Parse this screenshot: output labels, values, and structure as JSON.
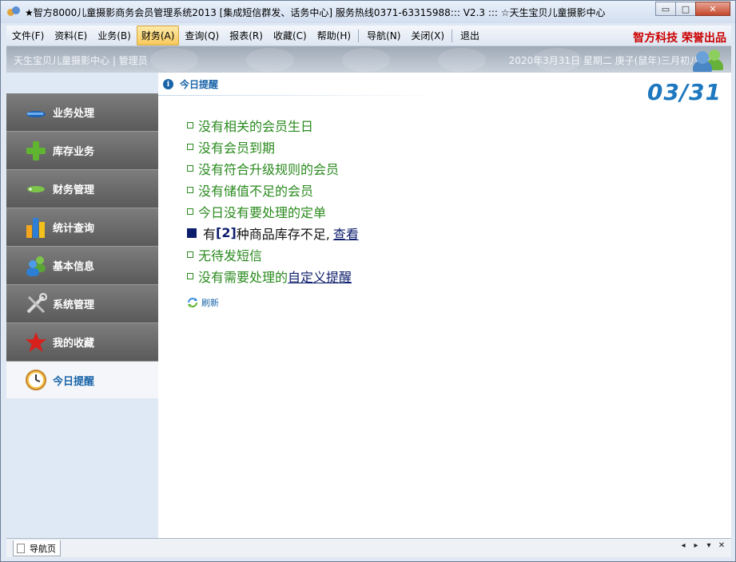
{
  "window": {
    "title": "★智方8000儿童摄影商务会员管理系统2013 [集成短信群发、话务中心] 服务热线0371-63315988::: V2.3 ::: ☆天生宝贝儿童摄影中心",
    "minimize_label": "▭",
    "maximize_label": "□",
    "close_label": "✕"
  },
  "menu": {
    "items": [
      "文件(F)",
      "资料(E)",
      "业务(B)",
      "财务(A)",
      "查询(Q)",
      "报表(R)",
      "收藏(C)",
      "帮助(H)",
      "导航(N)",
      "关闭(X)",
      "退出"
    ],
    "active": "财务(A)",
    "brand": "智方科技 荣誉出品"
  },
  "header": {
    "left": "天生宝贝儿童摄影中心 | 管理员",
    "right": "2020年3月31日  星期二  庚子(鼠年)三月初八"
  },
  "sidebar": {
    "items": [
      {
        "label": "业务处理",
        "icon": "pen-icon"
      },
      {
        "label": "库存业务",
        "icon": "plus-icon"
      },
      {
        "label": "财务管理",
        "icon": "tag-icon"
      },
      {
        "label": "统计查询",
        "icon": "bar-chart-icon"
      },
      {
        "label": "基本信息",
        "icon": "users-icon"
      },
      {
        "label": "系统管理",
        "icon": "tools-icon"
      },
      {
        "label": "我的收藏",
        "icon": "star-icon"
      },
      {
        "label": "今日提醒",
        "icon": "clock-icon"
      }
    ],
    "selected": "今日提醒"
  },
  "main": {
    "panel_title": "今日提醒",
    "date": "03/31",
    "alerts": [
      "没有相关的会员生日",
      "没有会员到期",
      "没有符合升级规则的会员",
      "没有储值不足的会员",
      "今日没有要处理的定单"
    ],
    "stock_alert": {
      "prefix": "有",
      "count": "[2]",
      "suffix": "种商品库存不足,",
      "link": "查看"
    },
    "sms_alert": "无待发短信",
    "custom_alert": {
      "prefix": "没有需要处理的",
      "link": "自定义提醒"
    },
    "refresh_label": "刷新"
  },
  "bottombar": {
    "tab_label": "导航页",
    "controls": [
      "◂",
      "▸",
      "▾",
      "✕"
    ]
  },
  "colors": {
    "alert_green": "#2a8a1e",
    "link_blue": "#0c1d6b",
    "brand_red": "#cc0000",
    "date_blue": "#1e78bf"
  }
}
